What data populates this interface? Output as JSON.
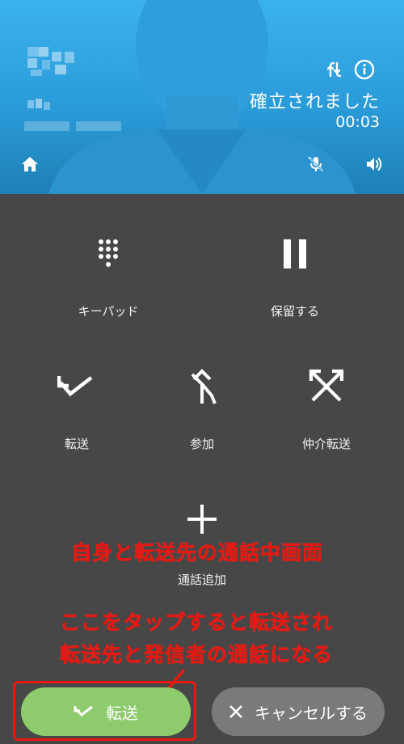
{
  "call": {
    "status": "確立されました",
    "timer": "00:03"
  },
  "controls": {
    "keypad": "キーパッド",
    "hold": "保留する",
    "transfer": "転送",
    "merge": "参加",
    "consult_transfer": "仲介転送",
    "add_call": "通話追加"
  },
  "annotations": {
    "screen_note": "自身と転送先の通話中画面",
    "tap_note_line1": "ここをタップすると転送され",
    "tap_note_line2": "転送先と発信者の通話になる",
    "color": "#e31b14"
  },
  "buttons": {
    "transfer": "転送",
    "cancel": "キャンセルする"
  },
  "colors": {
    "header": "#2a9bd9",
    "background": "#474747",
    "transfer_button": "#8dcb6c",
    "cancel_button": "#7a7a7a"
  }
}
